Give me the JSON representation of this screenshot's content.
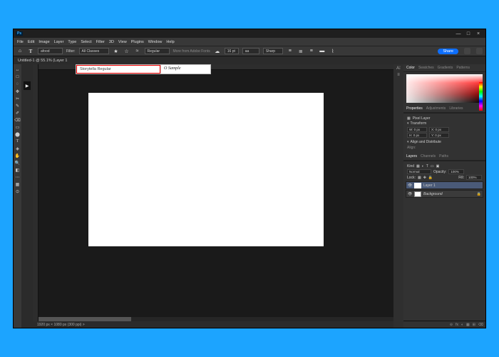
{
  "window": {
    "app": "Ps",
    "min": "—",
    "max": "□",
    "close": "×"
  },
  "menu": [
    "File",
    "Edit",
    "Image",
    "Layer",
    "Type",
    "Select",
    "Filter",
    "3D",
    "View",
    "Plugins",
    "Window",
    "Help"
  ],
  "options": {
    "home": "⌂",
    "type": "T",
    "fontFamily": "afood",
    "filterLabel": "Filter:",
    "filterSel": "All Classes",
    "styleSel": "Regular",
    "more": "More from Adobe Fonts",
    "aa": "aa",
    "sharp": "Sharp",
    "share": "Share"
  },
  "docTitle": "Untitled-1 @ 55.1% (Layer 1",
  "tools": [
    "↔",
    "□",
    "◌",
    "✥",
    "✂",
    "✎",
    "✐",
    "⌫",
    "▭",
    "⬤",
    "T",
    "◈",
    "✋",
    "🔍",
    "◧",
    "⋯",
    "▦",
    "⊙"
  ],
  "fontPopup": {
    "name": "Storytella Regular",
    "sample": "O  Sample"
  },
  "status": "1920 px × 1080 px (300 ppi)  >",
  "rightIconCol": [
    "A⁞",
    "≡"
  ],
  "colorTabs": {
    "color": "Color",
    "swatches": "Swatches",
    "gradients": "Gradients",
    "patterns": "Patterns"
  },
  "propsTabs": {
    "props": "Properties",
    "adjust": "Adjustments",
    "lib": "Libraries"
  },
  "propsKind": "Pixel Layer",
  "transform": {
    "title": "Transform",
    "x": "X: 0 px",
    "y": "Y: 0 px",
    "w": "W: 0 px",
    "h": "H: 0 px"
  },
  "align": {
    "title": "Align and Distribute",
    "sub": "Align:"
  },
  "layersTabs": {
    "layers": "Layers",
    "channels": "Channels",
    "paths": "Paths"
  },
  "layersOpts": {
    "kind": "Kind",
    "mode": "Normal",
    "opacityL": "Opacity:",
    "opacity": "100%",
    "lockL": "Lock:",
    "fillL": "Fill:",
    "fill": "100%"
  },
  "layerItems": [
    {
      "name": "Layer 1"
    },
    {
      "name": "Background"
    }
  ],
  "footIcons": [
    "⊝",
    "fx",
    "◐",
    "▦",
    "⊞",
    "⌫"
  ]
}
